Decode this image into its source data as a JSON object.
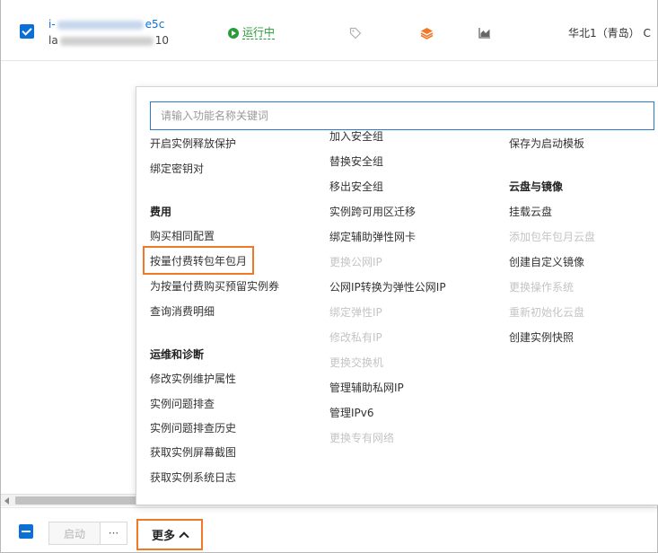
{
  "instance": {
    "id_prefix": "i-",
    "id_suffix": "e5c",
    "name_prefix": "la",
    "name_suffix": "10",
    "status": "运行中",
    "region": "华北1（青岛）",
    "region_trailing": "C"
  },
  "colors": {
    "primary": "#0b6fd8",
    "running": "#2a9d3b",
    "highlight": "#f07828",
    "disabled": "#c4c4c4"
  },
  "icons": [
    "tag-icon",
    "layers-icon",
    "monitor-chart-icon",
    "check-icon",
    "chevron-up-icon"
  ],
  "menu": {
    "search_placeholder": "请输入功能名称关键词",
    "col1": {
      "top_items": [
        "开启实例释放保护",
        "绑定密钥对"
      ],
      "billing_heading": "费用",
      "billing_items": [
        "购买相同配置",
        "按量付费转包年包月",
        "为按量付费购买预留实例券",
        "查询消费明细"
      ],
      "ops_heading": "运维和诊断",
      "ops_items": [
        "修改实例维护属性",
        "实例问题排查",
        "实例问题排查历史",
        "获取实例屏幕截图",
        "获取实例系统日志"
      ]
    },
    "col2": {
      "items": [
        "加入安全组",
        "替换安全组",
        "移出安全组",
        "实例跨可用区迁移",
        "绑定辅助弹性网卡",
        "更换公网IP",
        "公网IP转换为弹性公网IP",
        "绑定弹性IP",
        "修改私有IP",
        "更换交换机",
        "管理辅助私网IP",
        "管理IPv6",
        "更换专有网络"
      ]
    },
    "col3": {
      "top_item": "保存为启动模板",
      "disk_heading": "云盘与镜像",
      "disk_items": [
        "挂载云盘",
        "添加包年包月云盘",
        "创建自定义镜像",
        "更换操作系统",
        "重新初始化云盘",
        "创建实例快照"
      ]
    }
  },
  "bottom_bar": {
    "start_label": "启动",
    "ellipsis_label": "···",
    "more_label": "更多"
  }
}
